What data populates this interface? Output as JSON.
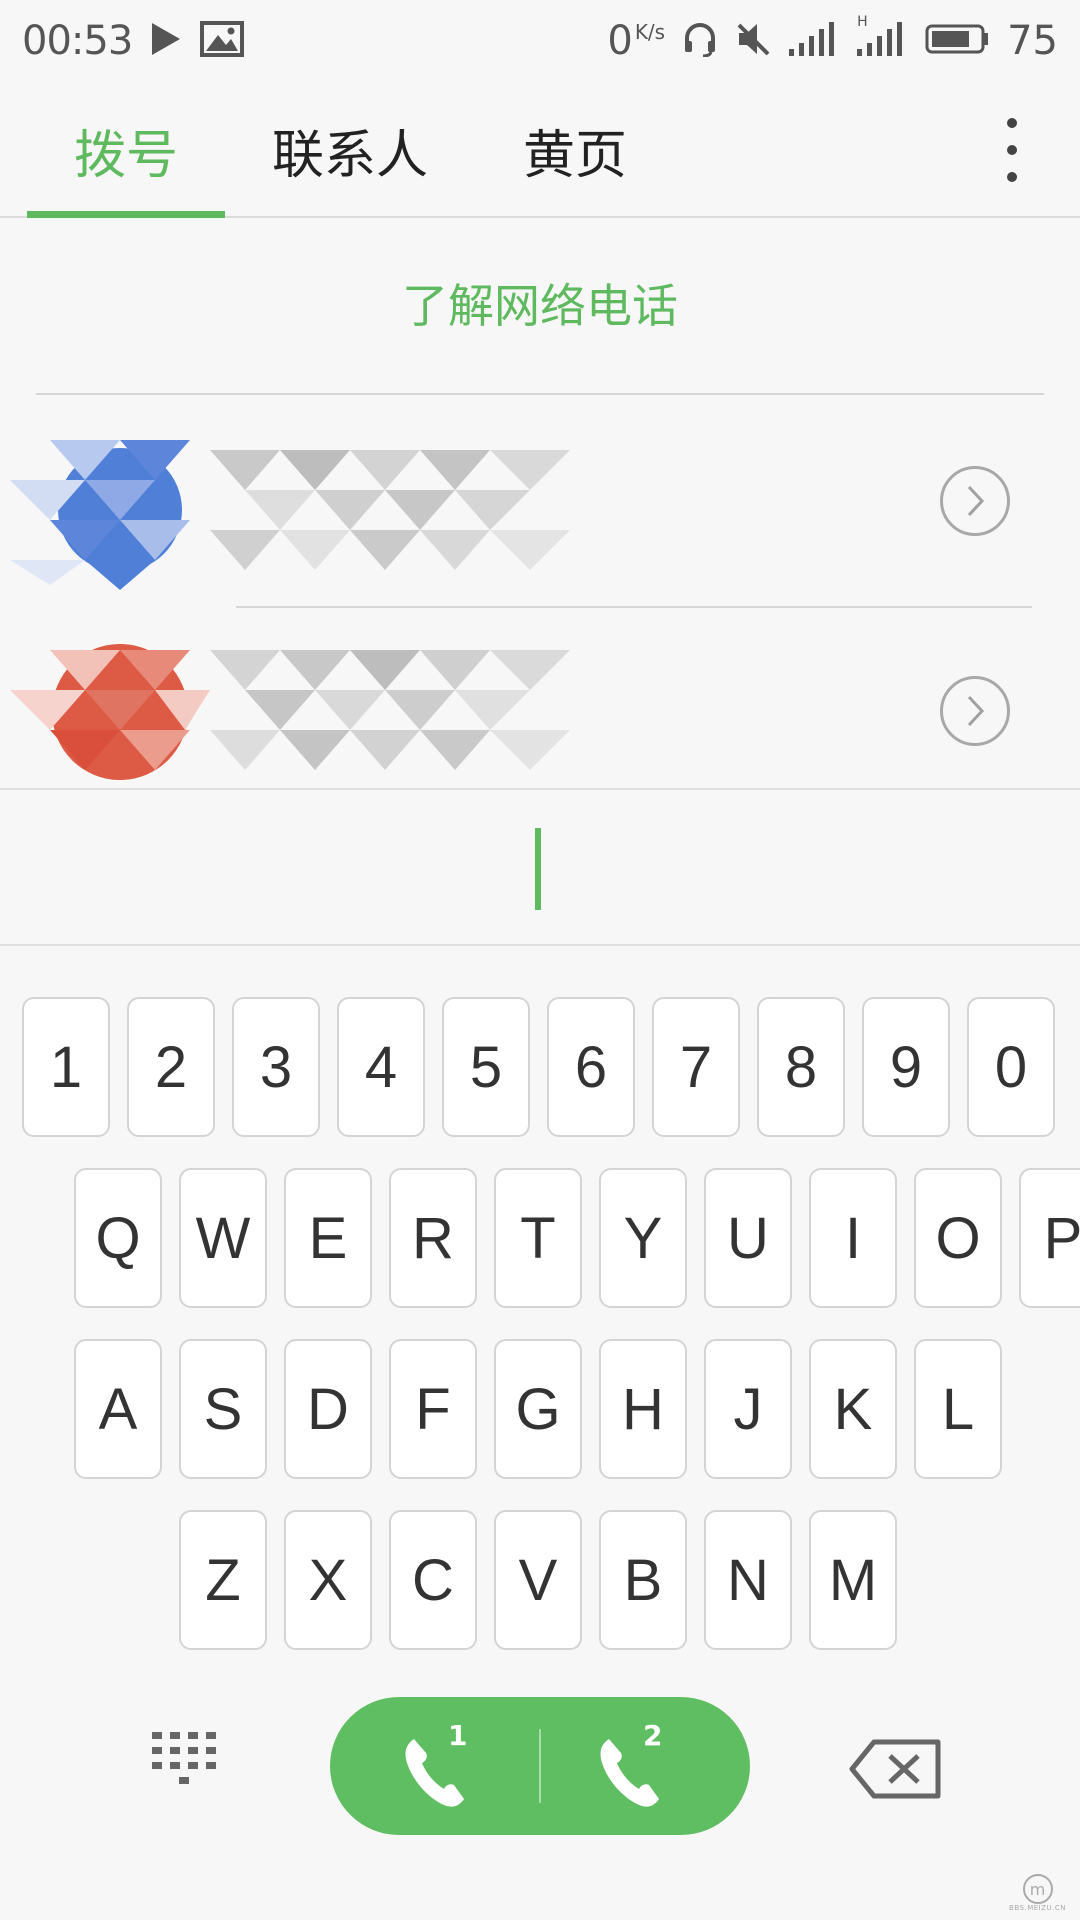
{
  "status_bar": {
    "time": "00:53",
    "net_speed_value": "0",
    "net_speed_unit": "K/s",
    "signal_2_label": "H",
    "battery_level": "75",
    "icons": [
      "play-icon",
      "image-icon",
      "headset-icon",
      "mute-icon",
      "signal-icon",
      "battery-icon"
    ]
  },
  "tabs": {
    "items": [
      {
        "label": "拨号",
        "active": true
      },
      {
        "label": "联系人",
        "active": false
      },
      {
        "label": "黄页",
        "active": false
      }
    ],
    "more_icon": "more-vert-icon"
  },
  "network_call_link": "了解网络电话",
  "recent_calls": [
    {
      "avatar_color": "#4f7fd6",
      "name": "",
      "arrow_icon": "chevron-right-icon"
    },
    {
      "avatar_color": "#dd5a45",
      "name": "",
      "arrow_icon": "chevron-right-icon"
    }
  ],
  "keyboard": {
    "rows": [
      [
        "1",
        "2",
        "3",
        "4",
        "5",
        "6",
        "7",
        "8",
        "9",
        "0"
      ],
      [
        "Q",
        "W",
        "E",
        "R",
        "T",
        "Y",
        "U",
        "I",
        "O",
        "P"
      ],
      [
        "A",
        "S",
        "D",
        "F",
        "G",
        "H",
        "J",
        "K",
        "L"
      ],
      [
        "Z",
        "X",
        "C",
        "V",
        "B",
        "N",
        "M"
      ]
    ]
  },
  "bottom_bar": {
    "dialpad_icon": "dialpad-icon",
    "sim1_label": "1",
    "sim2_label": "2",
    "backspace_icon": "backspace-icon"
  },
  "colors": {
    "accent": "#5fba5f",
    "call_button": "#5fbe62",
    "background": "#f7f7f7"
  },
  "watermark": "BBS.MEIZU.CN"
}
